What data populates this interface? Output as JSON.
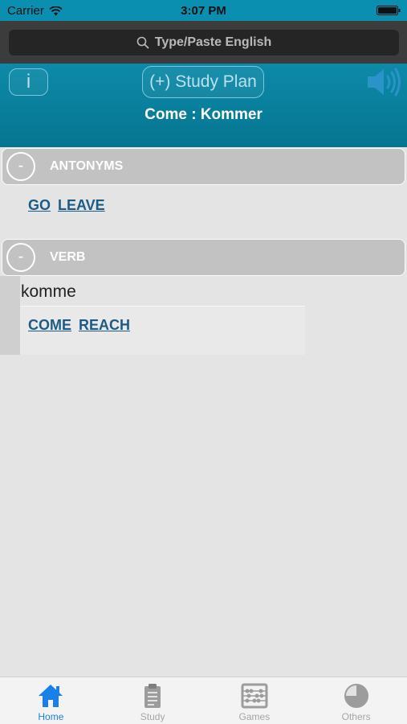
{
  "status_bar": {
    "carrier": "Carrier",
    "time": "3:07 PM"
  },
  "search": {
    "placeholder": "Type/Paste English",
    "icon": "search-icon"
  },
  "header": {
    "info_label": "i",
    "study_plan_label": "(+) Study Plan",
    "word_title": "Come : Kommer"
  },
  "sections": {
    "antonyms": {
      "toggle": "-",
      "title": "ANTONYMS",
      "links": [
        "GO",
        "LEAVE"
      ]
    },
    "verb": {
      "toggle": "-",
      "title": "VERB",
      "word": "komme",
      "links": [
        "COME",
        "REACH"
      ]
    }
  },
  "tabs": [
    {
      "label": "Home",
      "icon": "home-icon",
      "active": true
    },
    {
      "label": "Study",
      "icon": "clipboard-icon",
      "active": false
    },
    {
      "label": "Games",
      "icon": "abacus-icon",
      "active": false
    },
    {
      "label": "Others",
      "icon": "pie-chart-icon",
      "active": false
    }
  ],
  "colors": {
    "accent": "#0a8fb1",
    "active_tab": "#1a7fe9",
    "link": "#1c5b86",
    "section_header": "#c2c2c2"
  }
}
